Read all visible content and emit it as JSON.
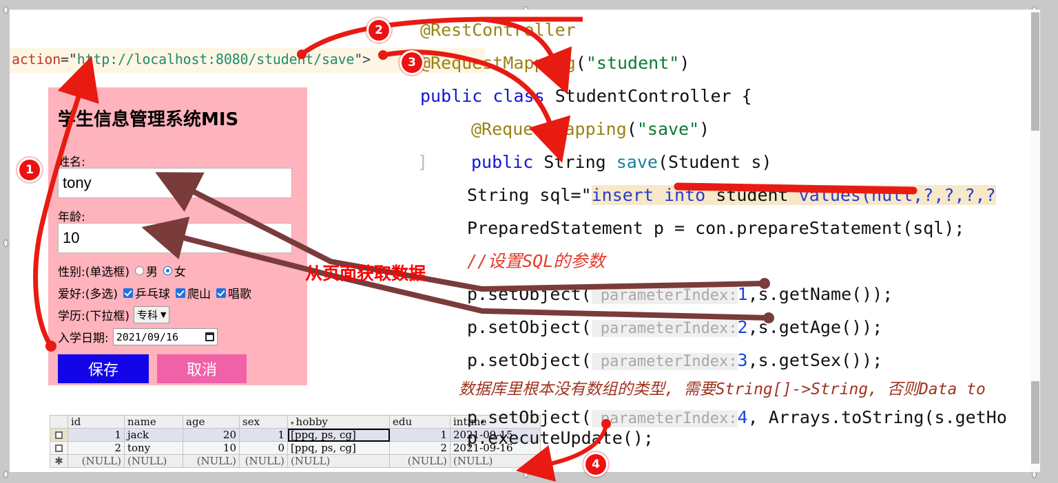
{
  "urlbar": {
    "attr": "action",
    "eq": "=\"",
    "url": "http://localhost:8080/student/save",
    "tail": "\">"
  },
  "form": {
    "title": "学生信息管理系统MIS",
    "name_label": "姓名:",
    "name_value": "tony",
    "age_label": "年龄:",
    "age_value": "10",
    "sex_label": "性别:(单选框)",
    "sex_male": "男",
    "sex_female": "女",
    "hobby_label": "爱好:(多选)",
    "hobby_1": "乒乓球",
    "hobby_2": "爬山",
    "hobby_3": "唱歌",
    "edu_label": "学历:(下拉框)",
    "edu_value": "专科",
    "date_label": "入学日期:",
    "date_value": "2021/09/16",
    "save_label": "保存",
    "cancel_label": "取消"
  },
  "grid": {
    "headers": [
      "",
      "id",
      "name",
      "age",
      "sex",
      "hobby",
      "edu",
      "intime"
    ],
    "sort_caret": "▾",
    "rows": [
      {
        "marker": "box",
        "id": "1",
        "name": "jack",
        "age": "20",
        "sex": "1",
        "hobby": "[ppq, ps, cg]",
        "edu": "1",
        "intime": "2021-09-15"
      },
      {
        "marker": "box",
        "id": "2",
        "name": "tony",
        "age": "10",
        "sex": "0",
        "hobby": "[ppq, ps, cg]",
        "edu": "2",
        "intime": "2021-09-16"
      },
      {
        "marker": "star",
        "id": "(NULL)",
        "name": "(NULL)",
        "age": "(NULL)",
        "sex": "(NULL)",
        "hobby": "(NULL)",
        "edu": "(NULL)",
        "intime": "(NULL)"
      }
    ],
    "star_glyph": "✱"
  },
  "code": {
    "line_stray_brace": "]",
    "l1_ann": "@RestController",
    "l2_ann": "@RequestMapping",
    "l2_open": "(",
    "l2_str": "\"student\"",
    "l2_close": ")",
    "l3_kw1": "public",
    "l3_kw2": "class",
    "l3_name": " StudentController {",
    "l4_ann": "@RequestMapping",
    "l4_open": "(",
    "l4_str": "\"save\"",
    "l4_close": ")",
    "l5_kw": "public",
    "l5_type": " String ",
    "l5_meth": "save",
    "l5_args": "(Student s)",
    "l6_pre": "String sql=\"",
    "l6_sql_kw1": "insert into",
    "l6_sql_tbl": " student ",
    "l6_sql_kw2": "values",
    "l6_sql_rest": "(null,?,?,?,?",
    "l7": "PreparedStatement p = con.prepareStatement(sql);",
    "l8_cmt": "//设置SQL的参数",
    "l9_pre": "p.setObject(",
    "l9_hint": " parameterIndex:",
    "l9_num": "1",
    "l9_post": ",s.getName());",
    "l10_pre": "p.setObject(",
    "l10_hint": " parameterIndex:",
    "l10_num": "2",
    "l10_post": ",s.getAge());",
    "l11_pre": "p.setObject(",
    "l11_hint": " parameterIndex:",
    "l11_num": "3",
    "l11_post": ",s.getSex());",
    "l12_cmt": "数据库里根本没有数组的类型, 需要String[]->String, 否则Data to",
    "l13_pre": "p.setObject(",
    "l13_hint": " parameterIndex:",
    "l13_num": "4",
    "l13_post": ", Arrays.toString(s.getHo",
    "l14": "p.executeUpdate();"
  },
  "annotations": {
    "badge1": "1",
    "badge2": "2",
    "badge3": "3",
    "badge4": "4",
    "note_get_data": "从页面获取数据"
  },
  "colors": {
    "badge_red": "#ee1111",
    "note_red": "#ff0000",
    "arrow_red": "#e81b12",
    "arrow_brown": "#7a3b3b",
    "form_pink": "#ffb3bd",
    "save_blue": "#1305e8",
    "cancel_pink": "#f062a8",
    "sql_highlight": "#f6e8c8",
    "urlbar_bg": "#fdf6e3"
  }
}
